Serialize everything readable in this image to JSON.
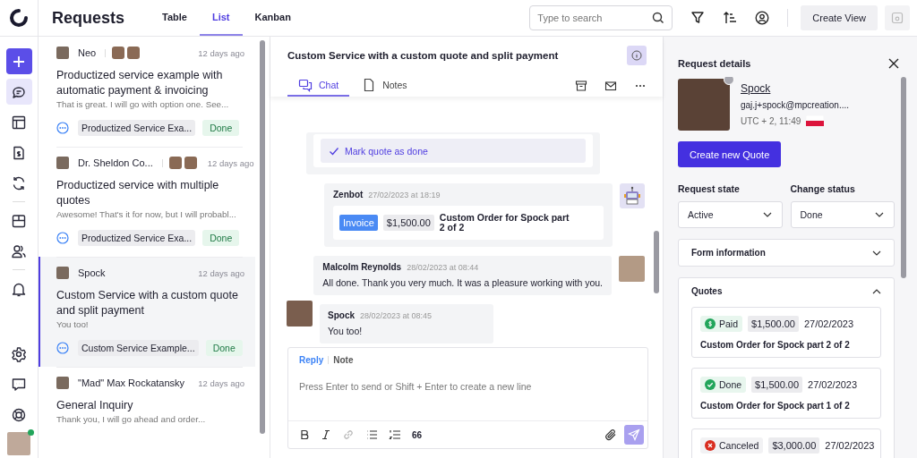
{
  "header": {
    "title": "Requests",
    "view_tabs": [
      {
        "label": "Table",
        "selected": false
      },
      {
        "label": "List",
        "selected": true
      },
      {
        "label": "Kanban",
        "selected": false
      }
    ],
    "search": {
      "placeholder": "Type to search"
    },
    "create_view": "Create View"
  },
  "nav": [
    {
      "kind": "plus",
      "selected": false
    },
    {
      "kind": "chat",
      "selected": true
    },
    {
      "kind": "layout",
      "selected": false
    },
    {
      "kind": "invoice",
      "selected": false
    },
    {
      "kind": "refresh",
      "selected": false
    },
    {
      "kind": "store",
      "selected": false
    },
    {
      "kind": "users",
      "selected": false
    },
    {
      "kind": "bell",
      "selected": false
    },
    {
      "kind": "settings",
      "selected": false
    },
    {
      "kind": "feedback",
      "selected": false
    },
    {
      "kind": "help",
      "selected": false
    }
  ],
  "user": {
    "online": true
  },
  "requests": [
    {
      "author": "Neo",
      "watchers": [
        {
          "kind": "photo"
        },
        {
          "kind": "photo"
        }
      ],
      "time": "12 days ago",
      "title": "Productized service example with automatic payment & invoicing",
      "preview": "That is great. I will go with option one. See...",
      "tag": "Productized Service Exa...",
      "status": "Done",
      "selected": false
    },
    {
      "author": "Dr. Sheldon Co...",
      "watchers": [
        {
          "kind": "photo"
        },
        {
          "kind": "photo"
        }
      ],
      "time": "12 days ago",
      "title": "Productized service with multiple quotes",
      "preview": "Awesome! That's it for now, but I will probabl...",
      "tag": "Productized Service Exa...",
      "status": "Done",
      "selected": false
    },
    {
      "author": "Spock",
      "time": "12 days ago",
      "title": "Custom Service with a custom quote and split payment",
      "preview": "You too!",
      "tag": "Custom Service Example...",
      "status": "Done",
      "selected": true
    },
    {
      "author": "\"Mad\" Max Rockatansky",
      "time": "12 days ago",
      "title": "General Inquiry",
      "preview": "Thank you, I will go ahead and order...",
      "selected": false
    }
  ],
  "chat": {
    "title": "Custom Service with a custom quote and split payment",
    "tabs": [
      {
        "label": "Chat",
        "kind": "chat",
        "selected": true
      },
      {
        "label": "Notes",
        "kind": "notes",
        "selected": false
      }
    ],
    "messages": [
      {
        "kind": "action",
        "action": "Mark quote as done"
      },
      {
        "kind": "invoice",
        "author": "Zenbot",
        "time": "27/02/2023 at 18:19",
        "badge": "Invoice",
        "amount": "$1,500.00",
        "item": "Custom Order for Spock part 2 of 2"
      },
      {
        "kind": "sent",
        "author": "Malcolm Reynolds",
        "time": "28/02/2023 at 08:44",
        "text": "All done. Thank you very much. It was a pleasure working with you."
      },
      {
        "kind": "received",
        "author": "Spock",
        "time": "28/02/2023 at 08:45",
        "text": "You too!"
      }
    ],
    "composer": {
      "modes": [
        {
          "label": "Reply",
          "selected": true
        },
        {
          "label": "Note",
          "selected": false
        }
      ],
      "placeholder": "Press Enter to send or Shift + Enter to create a new line",
      "quote_button": "66"
    }
  },
  "details": {
    "title": "Request details",
    "contact": {
      "name": "Spock",
      "email": "gaj.j+spock@mpcreation....",
      "timezone": "UTC + 2, 11:49",
      "online": false
    },
    "create_button": "Create new Quote",
    "fields": [
      {
        "label": "Request state",
        "value": "Active"
      },
      {
        "label": "Change status",
        "value": "Done"
      }
    ],
    "form_section": {
      "title": "Form information",
      "expanded": false
    },
    "quotes_section": {
      "title": "Quotes",
      "expanded": true
    },
    "quotes": [
      {
        "kind": "paid",
        "status": "Paid",
        "amount": "$1,500.00",
        "date": "27/02/2023",
        "title": "Custom Order for Spock part 2 of 2"
      },
      {
        "kind": "done",
        "status": "Done",
        "amount": "$1,500.00",
        "date": "27/02/2023",
        "title": "Custom Order for Spock part 1 of 2"
      },
      {
        "kind": "canceled",
        "status": "Canceled",
        "amount": "$3,000.00",
        "date": "27/02/2023"
      }
    ]
  }
}
